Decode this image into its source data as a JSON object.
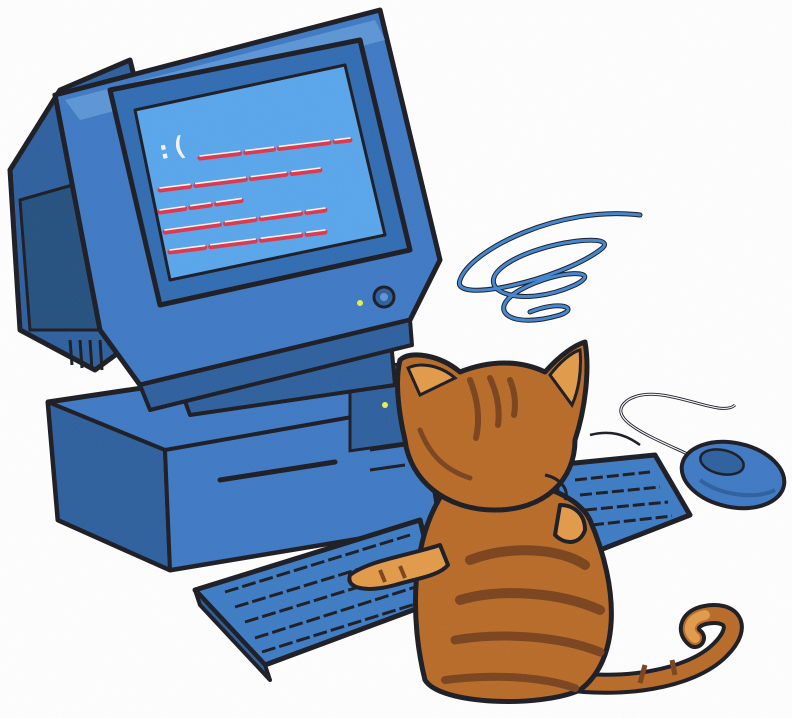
{
  "scene": {
    "screen_emoticon": ":(",
    "colors": {
      "outline": "#1a1a22",
      "monitor_face": "#3d79c4",
      "monitor_dark": "#2c5f9e",
      "monitor_light": "#5b95d6",
      "screen": "#58a5ec",
      "screen_bezel": "#2f6bb2",
      "error_line_red": "#e0344a",
      "error_line_white": "#f4f6ff",
      "keyboard": "#3c7bc4",
      "keys": "#2a5c98",
      "cat_fur": "#b86a26",
      "cat_stripes": "#7a421b",
      "cat_highlight": "#e39a48",
      "dizzy_scribble": "#3f86d3",
      "power_led": "#e8f04a"
    },
    "icons": [
      "sad-face-emoticon",
      "dizzy-scribble-icon",
      "power-button-icon",
      "power-led-icon"
    ]
  }
}
